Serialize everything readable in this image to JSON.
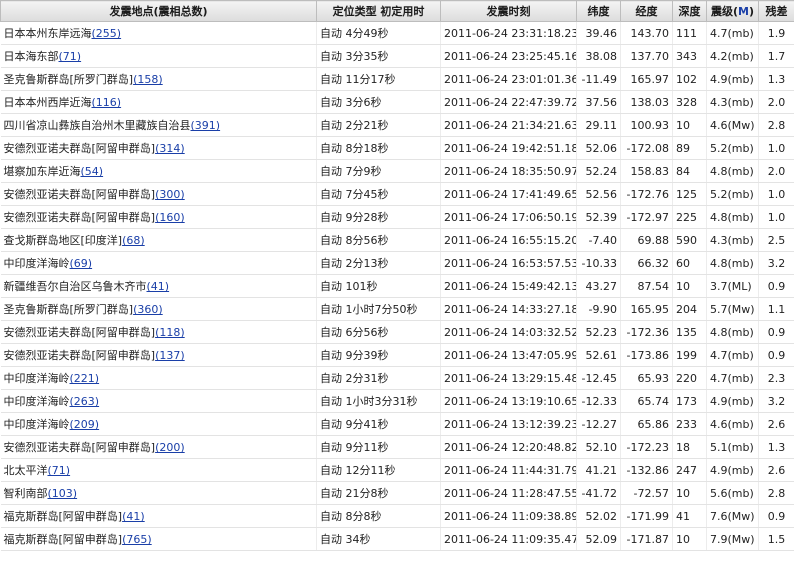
{
  "header": {
    "location": "发震地点(",
    "location_mid": "震相总数",
    "location_end": ")",
    "method": "定位类型 初定用时",
    "time": "发震时刻",
    "lat": "纬度",
    "lon": "经度",
    "depth": "深度",
    "mag": "震级(",
    "mag_unit": "M",
    "mag_end": ")",
    "residual": "残差"
  },
  "rows": [
    {
      "place": "日本本州东岸远海",
      "count": "(255)",
      "method": "自动 4分49秒",
      "time": "2011-06-24 23:31:18.230",
      "lat": "39.46",
      "lon": "143.70",
      "depth": "111",
      "mag": "4.7(mb)",
      "res": "1.9"
    },
    {
      "place": "日本海东部",
      "count": "(71)",
      "method": "自动 3分35秒",
      "time": "2011-06-24 23:25:45.160",
      "lat": "38.08",
      "lon": "137.70",
      "depth": "343",
      "mag": "4.2(mb)",
      "res": "1.7"
    },
    {
      "place": "圣克鲁斯群岛[所罗门群岛]",
      "count": "(158)",
      "method": "自动 11分17秒",
      "time": "2011-06-24 23:01:01.360",
      "lat": "-11.49",
      "lon": "165.97",
      "depth": "102",
      "mag": "4.9(mb)",
      "res": "1.3"
    },
    {
      "place": "日本本州西岸近海",
      "count": "(116)",
      "method": "自动 3分6秒",
      "time": "2011-06-24 22:47:39.720",
      "lat": "37.56",
      "lon": "138.03",
      "depth": "328",
      "mag": "4.3(mb)",
      "res": "2.0"
    },
    {
      "place": "四川省凉山彝族自治州木里藏族自治县",
      "count": "(391)",
      "method": "自动 2分21秒",
      "time": "2011-06-24 21:34:21.630",
      "lat": "29.11",
      "lon": "100.93",
      "depth": "10",
      "mag": "4.6(Mw)",
      "res": "2.8"
    },
    {
      "place": "安德烈亚诺夫群岛[阿留申群岛]",
      "count": "(314)",
      "method": "自动 8分18秒",
      "time": "2011-06-24 19:42:51.180",
      "lat": "52.06",
      "lon": "-172.08",
      "depth": "89",
      "mag": "5.2(mb)",
      "res": "1.0"
    },
    {
      "place": "堪察加东岸近海",
      "count": "(54)",
      "method": "自动 7分9秒",
      "time": "2011-06-24 18:35:50.970",
      "lat": "52.24",
      "lon": "158.83",
      "depth": "84",
      "mag": "4.8(mb)",
      "res": "2.0"
    },
    {
      "place": "安德烈亚诺夫群岛[阿留申群岛]",
      "count": "(300)",
      "method": "自动 7分45秒",
      "time": "2011-06-24 17:41:49.650",
      "lat": "52.56",
      "lon": "-172.76",
      "depth": "125",
      "mag": "5.2(mb)",
      "res": "1.0"
    },
    {
      "place": "安德烈亚诺夫群岛[阿留申群岛]",
      "count": "(160)",
      "method": "自动 9分28秒",
      "time": "2011-06-24 17:06:50.190",
      "lat": "52.39",
      "lon": "-172.97",
      "depth": "225",
      "mag": "4.8(mb)",
      "res": "1.0"
    },
    {
      "place": "查戈斯群岛地区[印度洋]",
      "count": "(68)",
      "method": "自动 8分56秒",
      "time": "2011-06-24 16:55:15.200",
      "lat": "-7.40",
      "lon": "69.88",
      "depth": "590",
      "mag": "4.3(mb)",
      "res": "2.5"
    },
    {
      "place": "中印度洋海岭",
      "count": "(69)",
      "method": "自动 2分13秒",
      "time": "2011-06-24 16:53:57.530",
      "lat": "-10.33",
      "lon": "66.32",
      "depth": "60",
      "mag": "4.8(mb)",
      "res": "3.2"
    },
    {
      "place": "新疆维吾尔自治区乌鲁木齐市",
      "count": "(41)",
      "method": "自动 101秒",
      "time": "2011-06-24 15:49:42.130",
      "lat": "43.27",
      "lon": "87.54",
      "depth": "10",
      "mag": "3.7(ML)",
      "res": "0.9"
    },
    {
      "place": "圣克鲁斯群岛[所罗门群岛]",
      "count": "(360)",
      "method": "自动 1小时7分50秒",
      "time": "2011-06-24 14:33:27.180",
      "lat": "-9.90",
      "lon": "165.95",
      "depth": "204",
      "mag": "5.7(Mw)",
      "res": "1.1"
    },
    {
      "place": "安德烈亚诺夫群岛[阿留申群岛]",
      "count": "(118)",
      "method": "自动 6分56秒",
      "time": "2011-06-24 14:03:32.520",
      "lat": "52.23",
      "lon": "-172.36",
      "depth": "135",
      "mag": "4.8(mb)",
      "res": "0.9"
    },
    {
      "place": "安德烈亚诺夫群岛[阿留申群岛]",
      "count": "(137)",
      "method": "自动 9分39秒",
      "time": "2011-06-24 13:47:05.990",
      "lat": "52.61",
      "lon": "-173.86",
      "depth": "199",
      "mag": "4.7(mb)",
      "res": "0.9"
    },
    {
      "place": "中印度洋海岭",
      "count": "(221)",
      "method": "自动 2分31秒",
      "time": "2011-06-24 13:29:15.480",
      "lat": "-12.45",
      "lon": "65.93",
      "depth": "220",
      "mag": "4.7(mb)",
      "res": "2.3"
    },
    {
      "place": "中印度洋海岭",
      "count": "(263)",
      "method": "自动 1小时3分31秒",
      "time": "2011-06-24 13:19:10.650",
      "lat": "-12.33",
      "lon": "65.74",
      "depth": "173",
      "mag": "4.9(mb)",
      "res": "3.2"
    },
    {
      "place": "中印度洋海岭",
      "count": "(209)",
      "method": "自动 9分41秒",
      "time": "2011-06-24 13:12:39.230",
      "lat": "-12.27",
      "lon": "65.86",
      "depth": "233",
      "mag": "4.6(mb)",
      "res": "2.6"
    },
    {
      "place": "安德烈亚诺夫群岛[阿留申群岛]",
      "count": "(200)",
      "method": "自动 9分11秒",
      "time": "2011-06-24 12:20:48.820",
      "lat": "52.10",
      "lon": "-172.23",
      "depth": "18",
      "mag": "5.1(mb)",
      "res": "1.3"
    },
    {
      "place": "北太平洋",
      "count": "(71)",
      "method": "自动 12分11秒",
      "time": "2011-06-24 11:44:31.790",
      "lat": "41.21",
      "lon": "-132.86",
      "depth": "247",
      "mag": "4.9(mb)",
      "res": "2.6"
    },
    {
      "place": "智利南部",
      "count": "(103)",
      "method": "自动 21分8秒",
      "time": "2011-06-24 11:28:47.550",
      "lat": "-41.72",
      "lon": "-72.57",
      "depth": "10",
      "mag": "5.6(mb)",
      "res": "2.8"
    },
    {
      "place": "福克斯群岛[阿留申群岛]",
      "count": "(41)",
      "method": "自动 8分8秒",
      "time": "2011-06-24 11:09:38.890",
      "lat": "52.02",
      "lon": "-171.99",
      "depth": "41",
      "mag": "7.6(Mw)",
      "res": "0.9"
    },
    {
      "place": "福克斯群岛[阿留申群岛]",
      "count": "(765)",
      "method": "自动 34秒",
      "time": "2011-06-24 11:09:35.470",
      "lat": "52.09",
      "lon": "-171.87",
      "depth": "10",
      "mag": "7.9(Mw)",
      "res": "1.5"
    }
  ]
}
